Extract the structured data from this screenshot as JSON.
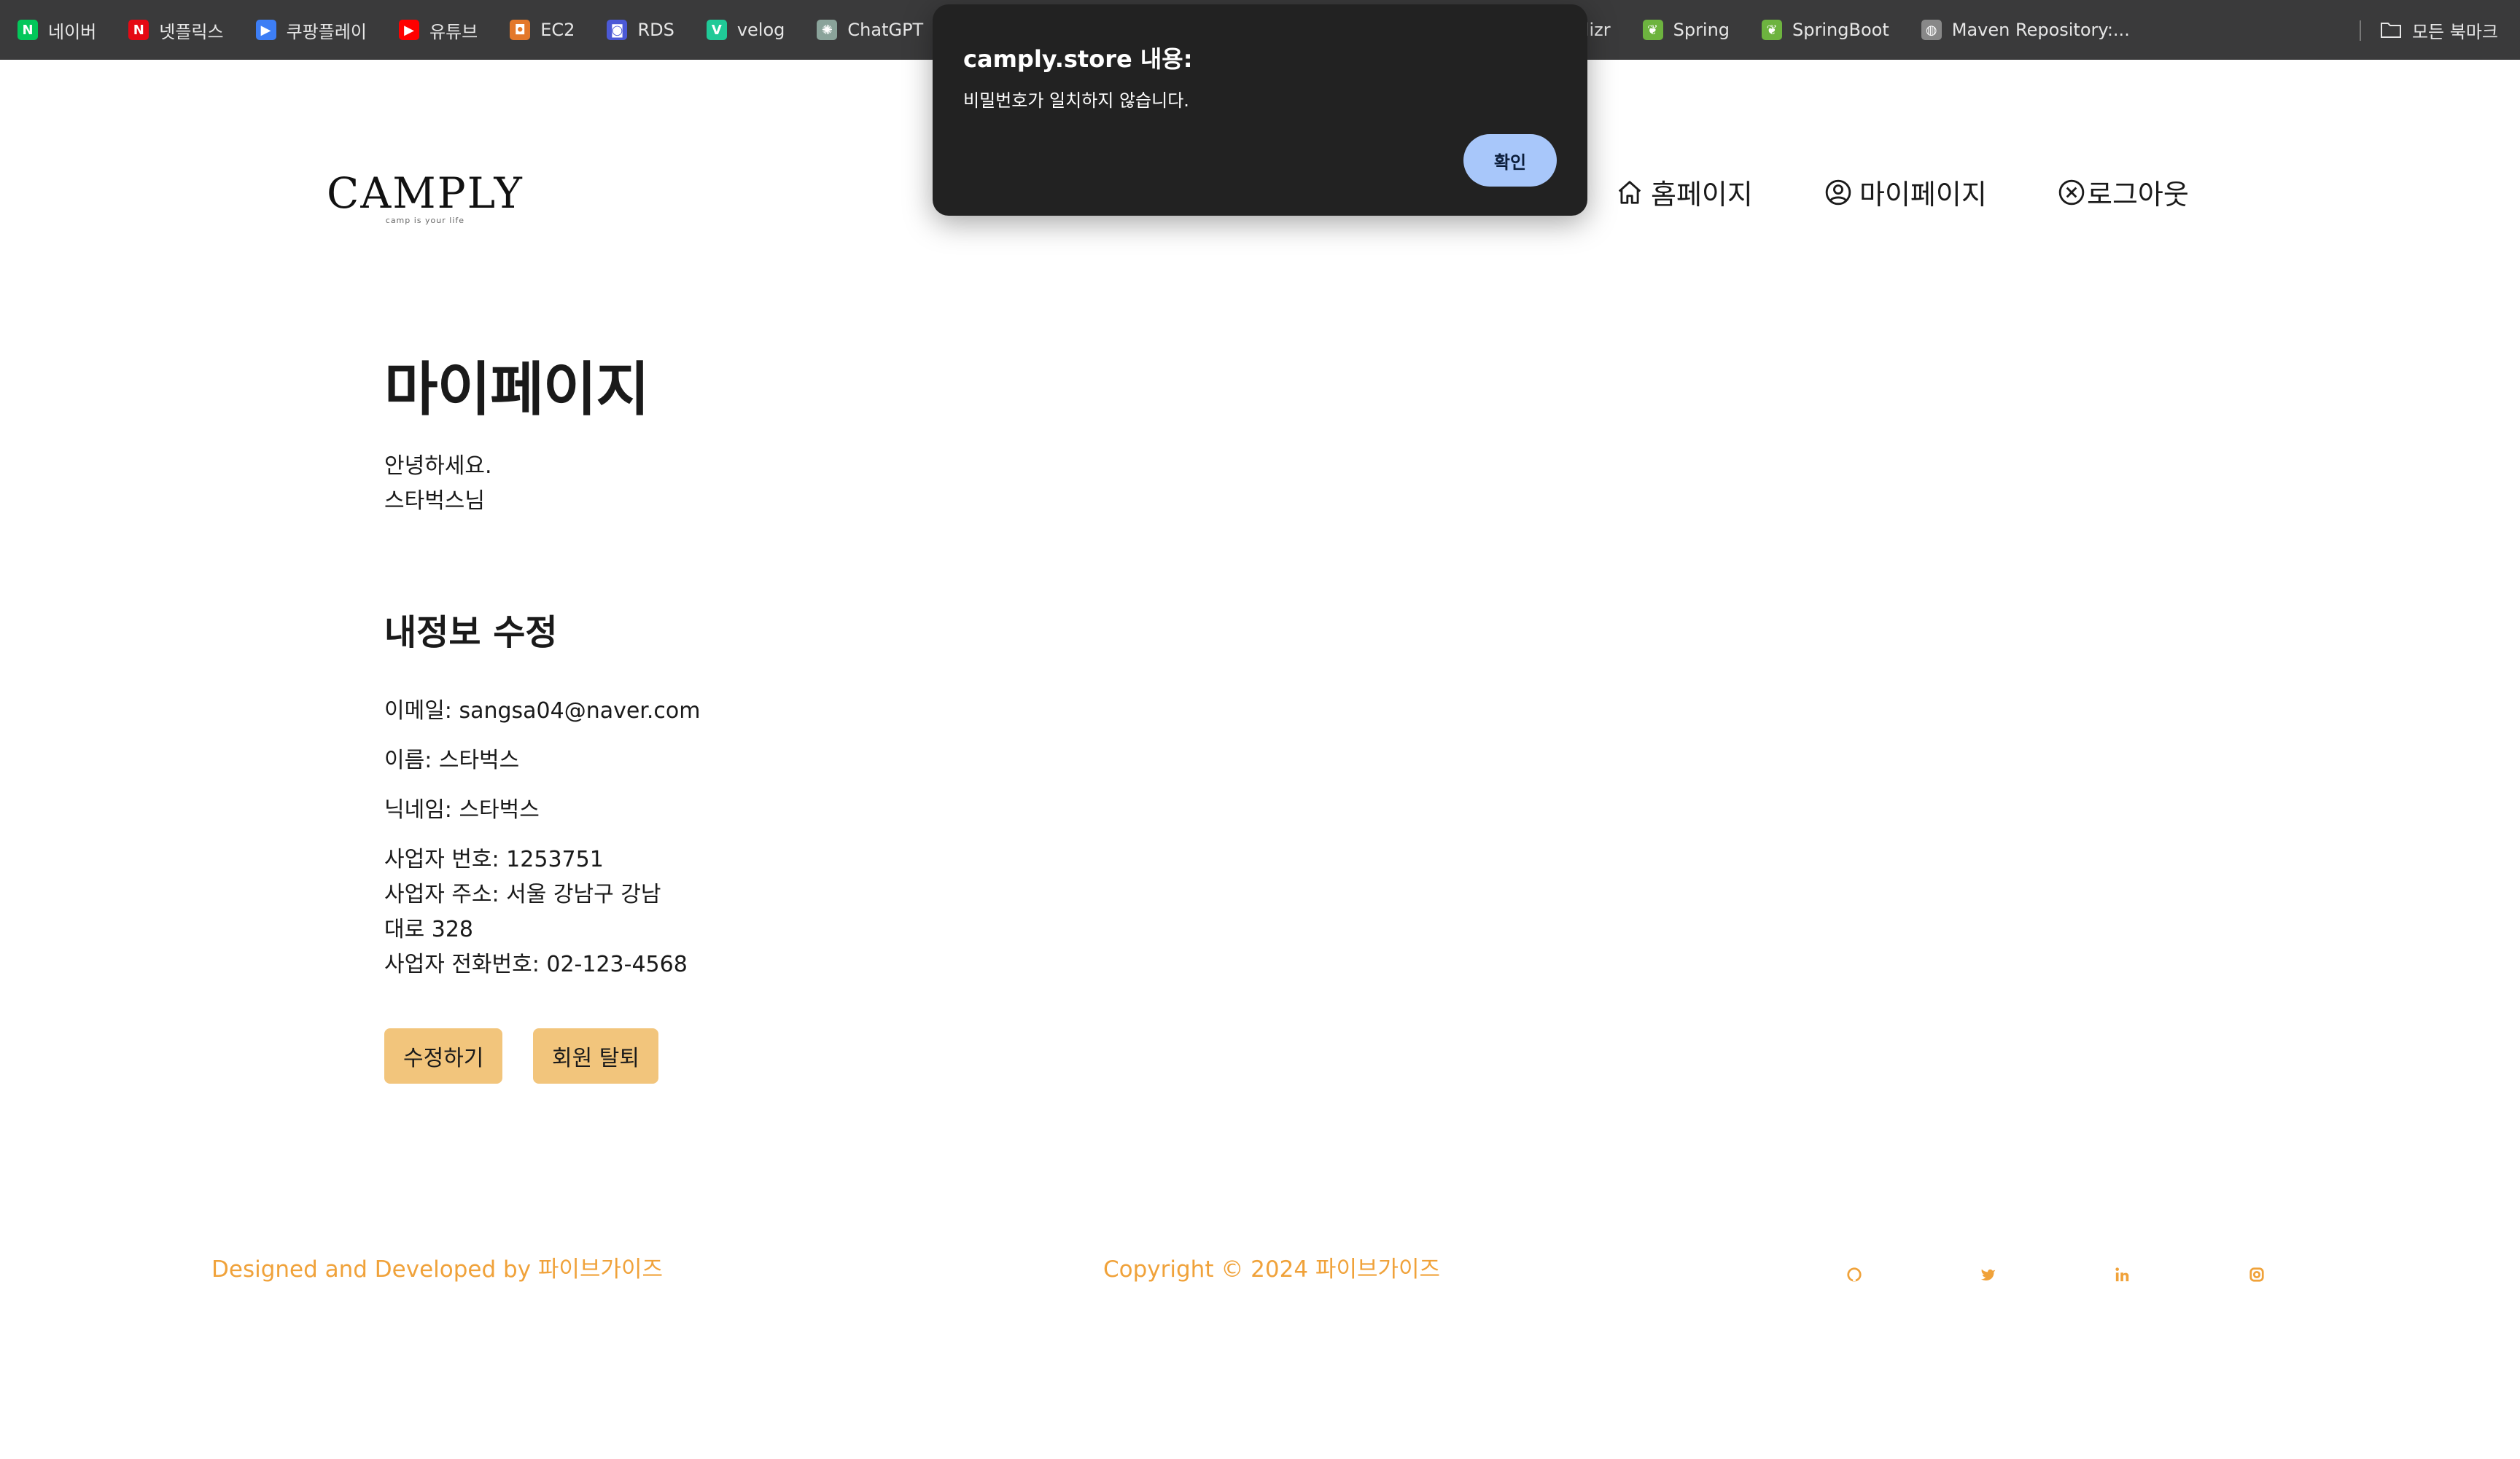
{
  "bookmarks": {
    "items": [
      {
        "label": "네이버",
        "icon": "naver-icon",
        "color": "#03c75a",
        "glyph": "N"
      },
      {
        "label": "넷플릭스",
        "icon": "netflix-icon",
        "color": "#e50914",
        "glyph": "N"
      },
      {
        "label": "쿠팡플레이",
        "icon": "coupang-play-icon",
        "color": "#3d7ef5",
        "glyph": "▶"
      },
      {
        "label": "유튜브",
        "icon": "youtube-icon",
        "color": "#ff0000",
        "glyph": "▶"
      },
      {
        "label": "EC2",
        "icon": "aws-ec2-icon",
        "color": "#e3782b",
        "glyph": "◘"
      },
      {
        "label": "RDS",
        "icon": "aws-rds-icon",
        "color": "#4b59d6",
        "glyph": "◙"
      },
      {
        "label": "velog",
        "icon": "velog-icon",
        "color": "#20c997",
        "glyph": "V"
      },
      {
        "label": "ChatGPT",
        "icon": "chatgpt-icon",
        "color": "#8aa39a",
        "glyph": "✺"
      }
    ],
    "right_items": [
      {
        "label": "tializr",
        "icon": "spring-initializr-icon",
        "color": "#6db33f",
        "glyph": ""
      },
      {
        "label": "Spring",
        "icon": "spring-icon",
        "color": "#6db33f",
        "glyph": "❦"
      },
      {
        "label": "SpringBoot",
        "icon": "springboot-icon",
        "color": "#6db33f",
        "glyph": "❦"
      },
      {
        "label": "Maven Repository:...",
        "icon": "globe-icon",
        "color": "#888888",
        "glyph": "◍"
      }
    ],
    "all_bookmarks": "모든 북마크"
  },
  "site": {
    "logo_name": "CAMPLY",
    "logo_tagline": "camp is your life",
    "nav": {
      "home": "홈페이지",
      "mypage": "마이페이지",
      "logout": "로그아웃"
    }
  },
  "page": {
    "title": "마이페이지",
    "greeting_1": "안녕하세요.",
    "greeting_2": "스타벅스님",
    "section_title": "내정보 수정",
    "email": "이메일: sangsa04@naver.com",
    "name": "이름: 스타벅스",
    "nickname": "닉네임: 스타벅스",
    "business_number": "사업자 번호: 1253751",
    "business_address_1": "사업자 주소: 서울 강남구 강남",
    "business_address_2": "대로 328",
    "business_phone": "사업자 전화번호: 02-123-4568",
    "edit_button": "수정하기",
    "withdraw_button": "회원 탈퇴"
  },
  "footer": {
    "left": "Designed and Developed by 파이브가이즈",
    "center": "Copyright © 2024 파이브가이즈",
    "social_icons": [
      "github-icon",
      "twitter-icon",
      "linkedin-icon",
      "instagram-icon"
    ],
    "accent_color": "#f0a23a"
  },
  "dialog": {
    "title": "camply.store 내용:",
    "message": "비밀번호가 일치하지 않습니다.",
    "ok_button": "확인"
  }
}
